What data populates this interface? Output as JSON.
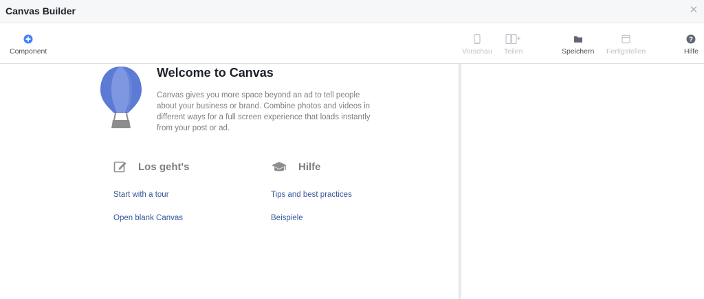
{
  "window": {
    "title": "Canvas Builder",
    "close_icon": "close-icon"
  },
  "toolbar": {
    "component_label": "Component",
    "preview_label": "Vorschau",
    "share_label": "Teilen",
    "save_label": "Speichern",
    "finish_label": "Fertigstellen",
    "help_label": "Hilfe"
  },
  "welcome": {
    "title": "Welcome to Canvas",
    "description": "Canvas gives you more space beyond an ad to tell people about your business or brand. Combine photos and videos in different ways for a full screen experience that loads instantly from your post or ad."
  },
  "sections": {
    "start": {
      "heading": "Los geht's",
      "links": [
        "Start with a tour",
        "Open blank Canvas"
      ]
    },
    "help": {
      "heading": "Hilfe",
      "links": [
        "Tips and best practices",
        "Beispiele"
      ]
    }
  },
  "colors": {
    "accent": "#4080ff",
    "link": "#365899",
    "balloon": "#5b7bd5",
    "disabled": "#bec2c9"
  }
}
